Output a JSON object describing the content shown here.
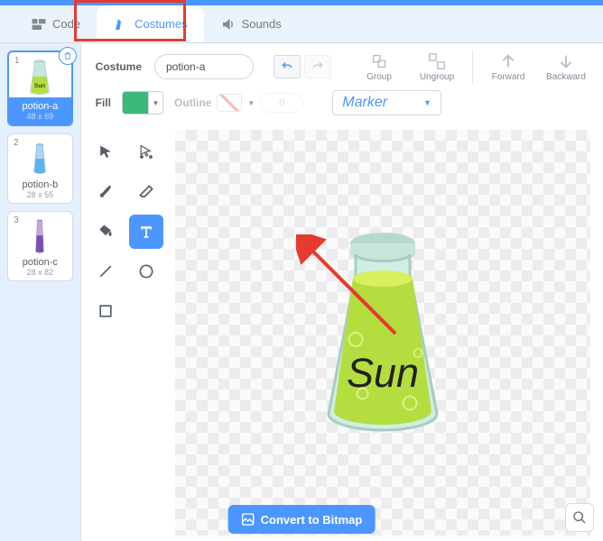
{
  "tabs": {
    "code": "Code",
    "costumes": "Costumes",
    "sounds": "Sounds"
  },
  "costumes": [
    {
      "name": "potion-a",
      "dim": "48 x 69"
    },
    {
      "name": "potion-b",
      "dim": "28 x 55"
    },
    {
      "name": "potion-c",
      "dim": "28 x 82"
    }
  ],
  "row1": {
    "costume_label": "Costume",
    "costume_name": "potion-a",
    "group": "Group",
    "ungroup": "Ungroup",
    "forward": "Forward",
    "backward": "Backward"
  },
  "row2": {
    "fill": "Fill",
    "outline": "Outline",
    "outline_width": "0",
    "font": "Marker"
  },
  "canvas": {
    "text_on_bottle": "Sun"
  },
  "convert": "Convert to Bitmap",
  "colors": {
    "fill": "#3cb878",
    "accent": "#4c97ff"
  }
}
